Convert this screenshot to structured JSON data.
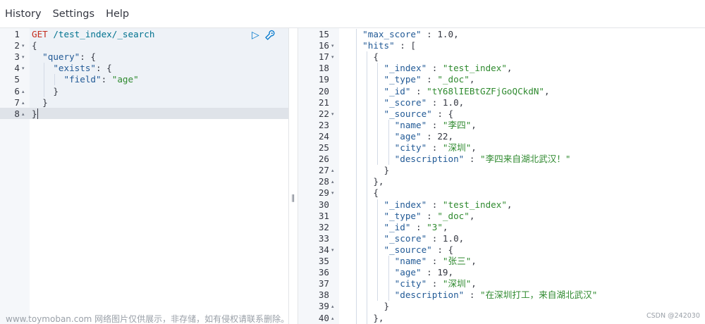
{
  "menu": [
    "History",
    "Settings",
    "Help"
  ],
  "request": {
    "lines": [
      {
        "n": "1",
        "fold": "",
        "segs": [
          [
            "tok-method",
            "GET"
          ],
          [
            "tok-p",
            " "
          ],
          [
            "tok-url",
            "/test_index/_search"
          ]
        ]
      },
      {
        "n": "2",
        "fold": "▾",
        "segs": [
          [
            "tok-p",
            "{"
          ]
        ]
      },
      {
        "n": "3",
        "fold": "▾",
        "segs": [
          [
            "tok-p",
            "  "
          ],
          [
            "tok-key",
            "\"query\""
          ],
          [
            "tok-p",
            ": {"
          ]
        ]
      },
      {
        "n": "4",
        "fold": "▾",
        "segs": [
          [
            "tok-p",
            "    "
          ],
          [
            "tok-key",
            "\"exists\""
          ],
          [
            "tok-p",
            ": {"
          ]
        ]
      },
      {
        "n": "5",
        "fold": "",
        "segs": [
          [
            "tok-p",
            "      "
          ],
          [
            "tok-key",
            "\"field\""
          ],
          [
            "tok-p",
            ": "
          ],
          [
            "tok-str",
            "\"age\""
          ]
        ]
      },
      {
        "n": "6",
        "fold": "▴",
        "segs": [
          [
            "tok-p",
            "    }"
          ]
        ]
      },
      {
        "n": "7",
        "fold": "▴",
        "segs": [
          [
            "tok-p",
            "  }"
          ]
        ]
      },
      {
        "n": "8",
        "fold": "▴",
        "segs": [
          [
            "tok-p",
            "}"
          ]
        ]
      }
    ],
    "actions": {
      "run_icon": "play-icon",
      "settings_icon": "wrench-icon"
    }
  },
  "response": {
    "lines": [
      {
        "n": "15",
        "fold": "",
        "segs": [
          [
            "tok-p",
            "  "
          ],
          [
            "tok-key",
            "\"max_score\""
          ],
          [
            "tok-p",
            " : "
          ],
          [
            "tok-num",
            "1.0"
          ],
          [
            "tok-p",
            ","
          ]
        ]
      },
      {
        "n": "16",
        "fold": "▾",
        "segs": [
          [
            "tok-p",
            "  "
          ],
          [
            "tok-key",
            "\"hits\""
          ],
          [
            "tok-p",
            " : ["
          ]
        ]
      },
      {
        "n": "17",
        "fold": "▾",
        "segs": [
          [
            "tok-p",
            "    {"
          ]
        ]
      },
      {
        "n": "18",
        "fold": "",
        "segs": [
          [
            "tok-p",
            "      "
          ],
          [
            "tok-key",
            "\"_index\""
          ],
          [
            "tok-p",
            " : "
          ],
          [
            "tok-str",
            "\"test_index\""
          ],
          [
            "tok-p",
            ","
          ]
        ]
      },
      {
        "n": "19",
        "fold": "",
        "segs": [
          [
            "tok-p",
            "      "
          ],
          [
            "tok-key",
            "\"_type\""
          ],
          [
            "tok-p",
            " : "
          ],
          [
            "tok-str",
            "\"_doc\""
          ],
          [
            "tok-p",
            ","
          ]
        ]
      },
      {
        "n": "20",
        "fold": "",
        "segs": [
          [
            "tok-p",
            "      "
          ],
          [
            "tok-key",
            "\"_id\""
          ],
          [
            "tok-p",
            " : "
          ],
          [
            "tok-str",
            "\"tY68lIEBtGZFjGoQCkdN\""
          ],
          [
            "tok-p",
            ","
          ]
        ]
      },
      {
        "n": "21",
        "fold": "",
        "segs": [
          [
            "tok-p",
            "      "
          ],
          [
            "tok-key",
            "\"_score\""
          ],
          [
            "tok-p",
            " : "
          ],
          [
            "tok-num",
            "1.0"
          ],
          [
            "tok-p",
            ","
          ]
        ]
      },
      {
        "n": "22",
        "fold": "▾",
        "segs": [
          [
            "tok-p",
            "      "
          ],
          [
            "tok-key",
            "\"_source\""
          ],
          [
            "tok-p",
            " : {"
          ]
        ]
      },
      {
        "n": "23",
        "fold": "",
        "segs": [
          [
            "tok-p",
            "        "
          ],
          [
            "tok-key",
            "\"name\""
          ],
          [
            "tok-p",
            " : "
          ],
          [
            "tok-str",
            "\"李四\""
          ],
          [
            "tok-p",
            ","
          ]
        ]
      },
      {
        "n": "24",
        "fold": "",
        "segs": [
          [
            "tok-p",
            "        "
          ],
          [
            "tok-key",
            "\"age\""
          ],
          [
            "tok-p",
            " : "
          ],
          [
            "tok-num",
            "22"
          ],
          [
            "tok-p",
            ","
          ]
        ]
      },
      {
        "n": "25",
        "fold": "",
        "segs": [
          [
            "tok-p",
            "        "
          ],
          [
            "tok-key",
            "\"city\""
          ],
          [
            "tok-p",
            " : "
          ],
          [
            "tok-str",
            "\"深圳\""
          ],
          [
            "tok-p",
            ","
          ]
        ]
      },
      {
        "n": "26",
        "fold": "",
        "segs": [
          [
            "tok-p",
            "        "
          ],
          [
            "tok-key",
            "\"description\""
          ],
          [
            "tok-p",
            " : "
          ],
          [
            "tok-str",
            "\"李四来自湖北武汉！\""
          ]
        ]
      },
      {
        "n": "27",
        "fold": "▴",
        "segs": [
          [
            "tok-p",
            "      }"
          ]
        ]
      },
      {
        "n": "28",
        "fold": "▴",
        "segs": [
          [
            "tok-p",
            "    },"
          ]
        ]
      },
      {
        "n": "29",
        "fold": "▾",
        "segs": [
          [
            "tok-p",
            "    {"
          ]
        ]
      },
      {
        "n": "30",
        "fold": "",
        "segs": [
          [
            "tok-p",
            "      "
          ],
          [
            "tok-key",
            "\"_index\""
          ],
          [
            "tok-p",
            " : "
          ],
          [
            "tok-str",
            "\"test_index\""
          ],
          [
            "tok-p",
            ","
          ]
        ]
      },
      {
        "n": "31",
        "fold": "",
        "segs": [
          [
            "tok-p",
            "      "
          ],
          [
            "tok-key",
            "\"_type\""
          ],
          [
            "tok-p",
            " : "
          ],
          [
            "tok-str",
            "\"_doc\""
          ],
          [
            "tok-p",
            ","
          ]
        ]
      },
      {
        "n": "32",
        "fold": "",
        "segs": [
          [
            "tok-p",
            "      "
          ],
          [
            "tok-key",
            "\"_id\""
          ],
          [
            "tok-p",
            " : "
          ],
          [
            "tok-str",
            "\"3\""
          ],
          [
            "tok-p",
            ","
          ]
        ]
      },
      {
        "n": "33",
        "fold": "",
        "segs": [
          [
            "tok-p",
            "      "
          ],
          [
            "tok-key",
            "\"_score\""
          ],
          [
            "tok-p",
            " : "
          ],
          [
            "tok-num",
            "1.0"
          ],
          [
            "tok-p",
            ","
          ]
        ]
      },
      {
        "n": "34",
        "fold": "▾",
        "segs": [
          [
            "tok-p",
            "      "
          ],
          [
            "tok-key",
            "\"_source\""
          ],
          [
            "tok-p",
            " : {"
          ]
        ]
      },
      {
        "n": "35",
        "fold": "",
        "segs": [
          [
            "tok-p",
            "        "
          ],
          [
            "tok-key",
            "\"name\""
          ],
          [
            "tok-p",
            " : "
          ],
          [
            "tok-str",
            "\"张三\""
          ],
          [
            "tok-p",
            ","
          ]
        ]
      },
      {
        "n": "36",
        "fold": "",
        "segs": [
          [
            "tok-p",
            "        "
          ],
          [
            "tok-key",
            "\"age\""
          ],
          [
            "tok-p",
            " : "
          ],
          [
            "tok-num",
            "19"
          ],
          [
            "tok-p",
            ","
          ]
        ]
      },
      {
        "n": "37",
        "fold": "",
        "segs": [
          [
            "tok-p",
            "        "
          ],
          [
            "tok-key",
            "\"city\""
          ],
          [
            "tok-p",
            " : "
          ],
          [
            "tok-str",
            "\"深圳\""
          ],
          [
            "tok-p",
            ","
          ]
        ]
      },
      {
        "n": "38",
        "fold": "",
        "segs": [
          [
            "tok-p",
            "        "
          ],
          [
            "tok-key",
            "\"description\""
          ],
          [
            "tok-p",
            " : "
          ],
          [
            "tok-str",
            "\"在深圳打工，来自湖北武汉\""
          ]
        ]
      },
      {
        "n": "39",
        "fold": "▴",
        "segs": [
          [
            "tok-p",
            "      }"
          ]
        ]
      },
      {
        "n": "40",
        "fold": "▴",
        "segs": [
          [
            "tok-p",
            "    },"
          ]
        ]
      }
    ]
  },
  "divider_handle": "‖",
  "watermark": "www.toymoban.com 网络图片仅供展示，非存储，如有侵权请联系删除。",
  "csdn_badge": "CSDN @242030"
}
